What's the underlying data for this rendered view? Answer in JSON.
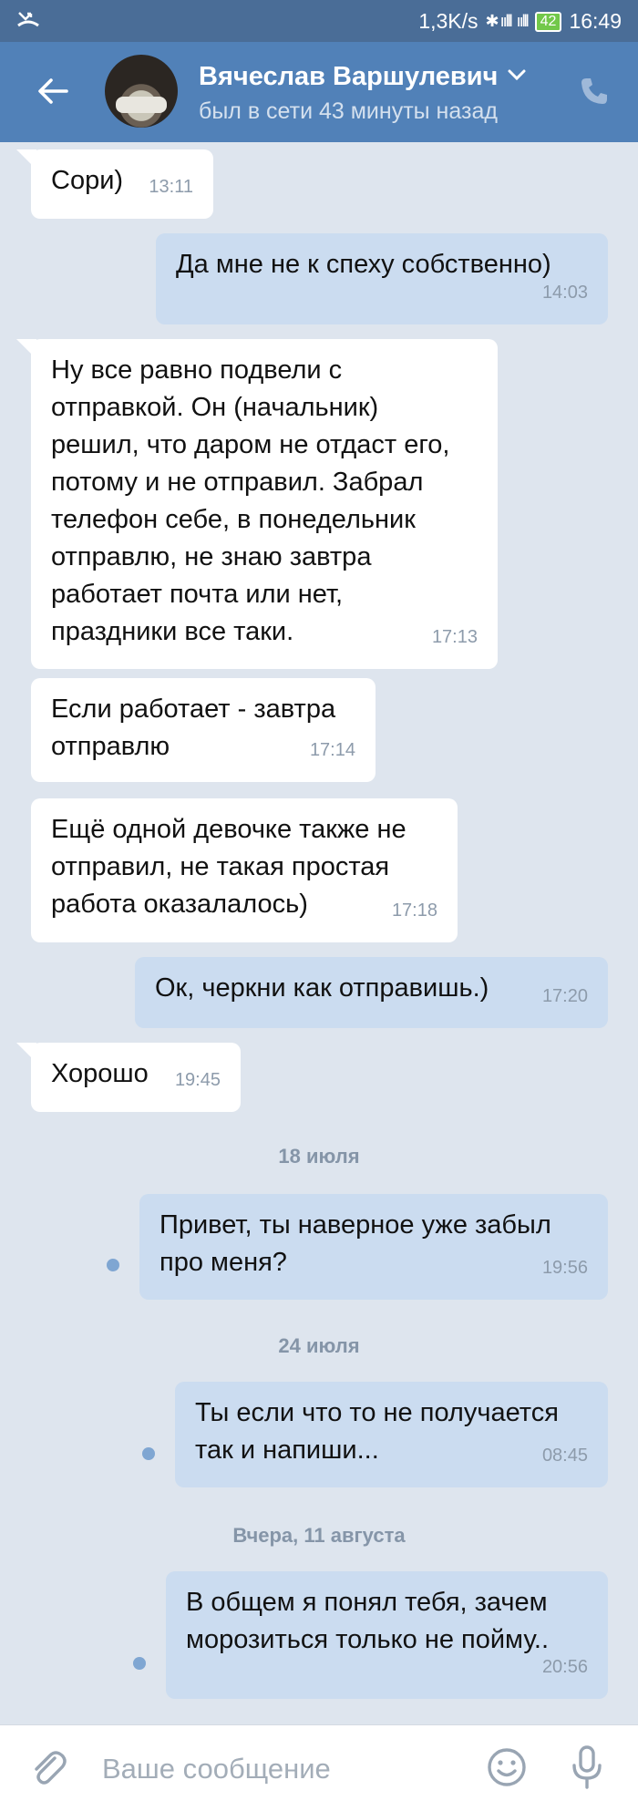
{
  "status_bar": {
    "speed": "1,3K/s",
    "battery": "42",
    "time": "16:49"
  },
  "header": {
    "name": "Вячеслав Варшулевич",
    "status": "был в сети 43 минуты назад"
  },
  "messages": [
    {
      "text": "Сори)",
      "time": "13:11"
    },
    {
      "text": "Да мне не к спеху собственно)",
      "time": "14:03"
    },
    {
      "text": "Ну все равно подвели с\nотправкой. Он (начальник)\nрешил, что даром не отдаст его,\nпотому и не отправил. Забрал\nтелефон себе, в понедельник\nотправлю, не знаю завтра\nработает почта или нет,\nпраздники все таки.",
      "time": "17:13"
    },
    {
      "text": "Если работает - завтра\nотправлю",
      "time": "17:14"
    },
    {
      "text": "Ещё одной девочке также не\nотправил, не такая простая\nработа оказалалось)",
      "time": "17:18"
    },
    {
      "text": "Ок, черкни как отправишь.)",
      "time": "17:20"
    },
    {
      "text": "Хорошо",
      "time": "19:45"
    },
    {
      "text": "Привет, ты наверное уже забыл\nпро меня?",
      "time": "19:56"
    },
    {
      "text": "Ты если что то не получается\nтак и напиши...",
      "time": "08:45"
    },
    {
      "text": "В общем я понял тебя, зачем\nморозиться только не пойму..",
      "time": "20:56"
    }
  ],
  "dates": [
    "18 июля",
    "24 июля",
    "Вчера, 11 августа"
  ],
  "composer": {
    "placeholder": "Ваше сообщение"
  },
  "colors": {
    "header": "#5181b8",
    "status_bar": "#4a6d97",
    "background": "#dee5ee",
    "incoming_bubble": "#ffffff",
    "outgoing_bubble": "#cbdcf0"
  },
  "icons": [
    "back-arrow-icon",
    "chevron-down-icon",
    "phone-icon",
    "paperclip-icon",
    "emoji-icon",
    "microphone-icon"
  ]
}
